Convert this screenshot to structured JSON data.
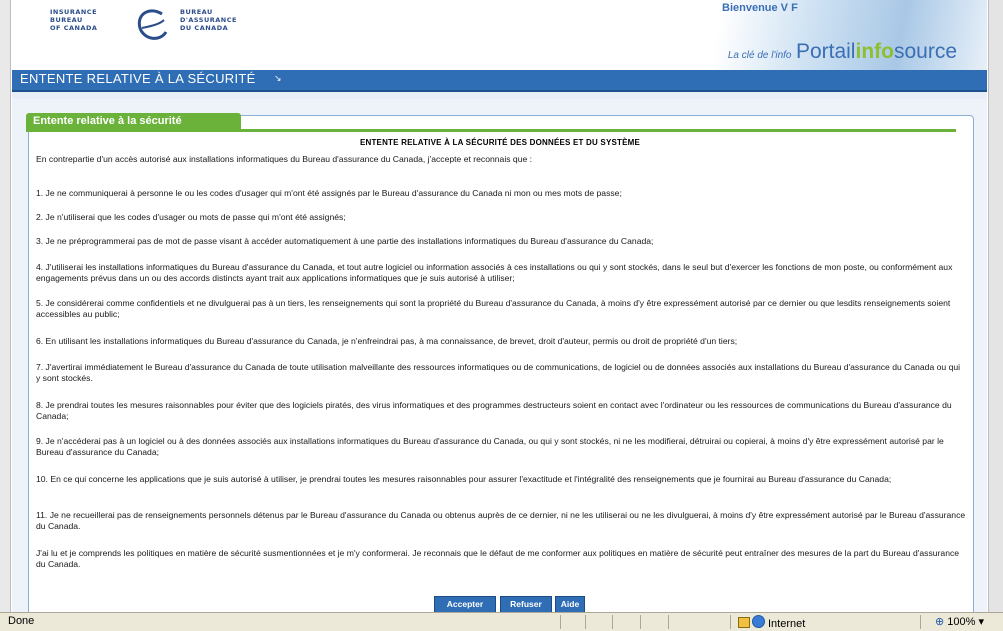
{
  "header": {
    "logo_left": [
      "INSURANCE",
      "BUREAU",
      "OF CANADA"
    ],
    "logo_right": [
      "BUREAU",
      "D'ASSURANCE",
      "DU CANADA"
    ],
    "welcome": "Bienvenue V F",
    "tagline": "La clé de l'info",
    "portal_word1": "Portail",
    "portal_word2": "info",
    "portal_word3": "source"
  },
  "titlebar": {
    "title": "ENTENTE RELATIVE À LA SÉCURITÉ"
  },
  "panel": {
    "tab_label": "Entente relative à la sécurité",
    "doc_title": "ENTENTE RELATIVE À LA SÉCURITÉ DES DONNÉES ET DU SYSTÈME",
    "paragraphs": [
      "En contrepartie d'un accès autorisé aux installations informatiques du Bureau d'assurance du Canada, j'accepte et reconnais que :",
      "1. Je ne communiquerai à personne le ou les codes d'usager qui m'ont été assignés par le Bureau d'assurance du Canada ni mon ou mes mots de passe;",
      "2. Je n'utiliserai que les codes d'usager ou mots de passe qui m'ont été assignés;",
      "3. Je ne préprogrammerai pas de mot de passe visant à accéder automatiquement à une partie des installations informatiques du Bureau d'assurance du Canada;",
      "4. J'utiliserai les installations informatiques du Bureau d'assurance du Canada, et tout autre logiciel ou information associés à ces installations ou qui y sont stockés, dans le seul but d'exercer les fonctions de mon poste, ou conformément aux engagements prévus dans un ou des accords distincts ayant trait aux applications informatiques que je suis autorisé à utiliser;",
      "5. Je considérerai comme confidentiels et ne divulguerai pas à un tiers, les renseignements qui sont la propriété du Bureau d'assurance du Canada, à moins d'y être expressément autorisé par ce dernier ou que lesdits renseignements soient accessibles au public;",
      "6. En utilisant les installations informatiques du Bureau d'assurance du Canada, je n'enfreindrai pas, à ma connaissance, de brevet, droit d'auteur, permis ou droit de propriété d'un tiers;",
      "7. J'avertirai immédiatement le Bureau d'assurance du Canada de toute utilisation malveillante des ressources informatiques ou de communications, de logiciel ou de données associés aux installations du Bureau d'assurance du Canada ou qui y sont stockés.",
      "8. Je prendrai toutes les mesures raisonnables pour éviter que des logiciels piratés, des virus informatiques et des programmes destructeurs soient en contact avec l'ordinateur ou les ressources de communications du Bureau d'assurance du Canada;",
      "9. Je n'accéderai pas à un logiciel ou à des données associés aux installations informatiques du Bureau d'assurance du Canada, ou qui y sont stockés, ni ne les modifierai, détruirai ou copierai, à moins d'y être expressément autorisé par le Bureau d'assurance du Canada;",
      "10. En ce qui concerne les applications que je suis autorisé à utiliser, je prendrai toutes les mesures raisonnables pour assurer l'exactitude et l'intégralité des renseignements que je fournirai au Bureau d'assurance du Canada;",
      "11. Je ne recueillerai pas de renseignements personnels détenus par le Bureau d'assurance du Canada ou obtenus auprès de ce dernier, ni ne les utiliserai ou ne les divulguerai, à moins d'y être expressément autorisé par le Bureau d'assurance du Canada.",
      "J'ai lu et je comprends les politiques en matière de sécurité susmentionnées et je m'y conformerai. Je reconnais que le défaut de me conformer aux politiques en matière de sécurité peut entraîner des mesures de la part du Bureau d'assurance du Canada."
    ]
  },
  "buttons": {
    "accept": "Accepter",
    "refuse": "Refuser",
    "help": "Aide"
  },
  "statusbar": {
    "status": "Done",
    "zone": "Internet",
    "zoom": "100%"
  },
  "colors": {
    "brand_blue": "#2f6db4",
    "brand_green": "#6ab23a"
  }
}
